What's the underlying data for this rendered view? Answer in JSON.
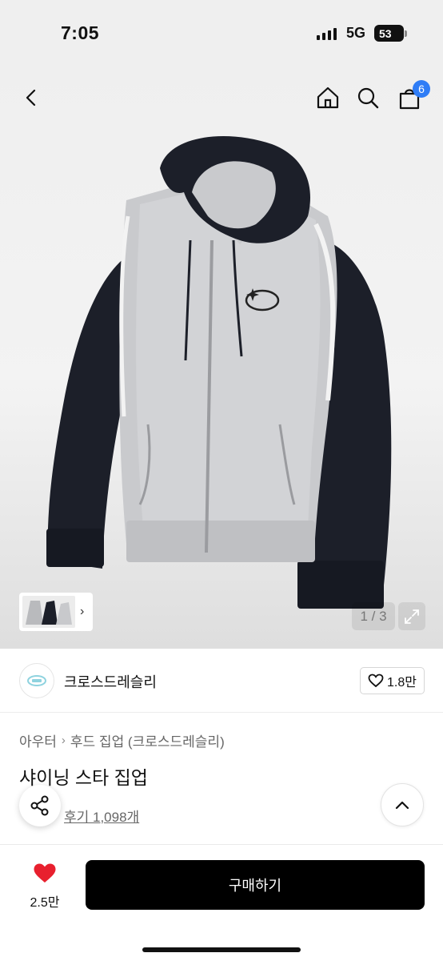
{
  "status_bar": {
    "time": "7:05",
    "network": "5G",
    "battery": "53"
  },
  "nav": {
    "cart_count": "6"
  },
  "gallery": {
    "counter": "1 / 3"
  },
  "brand": {
    "name": "크로스드레슬리",
    "likes": "1.8만"
  },
  "breadcrumb": {
    "category": "아우터",
    "subcategory": "후드 집업 (크로스드레슬리)"
  },
  "product": {
    "title": "샤이닝 스타 집업",
    "reviews": "후기 1,098개"
  },
  "bottom": {
    "wish_count": "2.5만",
    "buy_label": "구매하기"
  },
  "colors": {
    "accent": "#2f7df6",
    "heart": "#e8202e",
    "buy": "#000000"
  },
  "icons": [
    "back-icon",
    "home-icon",
    "search-icon",
    "cart-icon",
    "chevron-right-icon",
    "expand-icon",
    "heart-outline-icon",
    "share-icon",
    "chevron-up-icon",
    "heart-filled-icon"
  ]
}
